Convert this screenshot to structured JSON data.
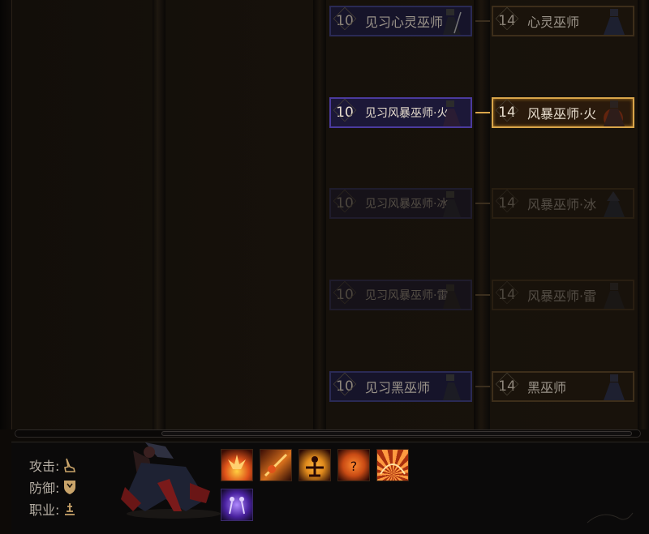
{
  "tree": {
    "rows": [
      {
        "left": {
          "level": "10",
          "name": "见习心灵巫师",
          "state": "normal"
        },
        "right": {
          "level": "14",
          "name": "心灵巫师",
          "state": "normal"
        }
      },
      {
        "left": {
          "level": "10",
          "name": "见习风暴巫师·火",
          "state": "active"
        },
        "right": {
          "level": "14",
          "name": "风暴巫师·火",
          "state": "selected"
        }
      },
      {
        "left": {
          "level": "10",
          "name": "见习风暴巫师·冰",
          "state": "dim"
        },
        "right": {
          "level": "14",
          "name": "风暴巫师·冰",
          "state": "dim"
        }
      },
      {
        "left": {
          "level": "10",
          "name": "见习风暴巫师·雷",
          "state": "dim"
        },
        "right": {
          "level": "14",
          "name": "风暴巫师·雷",
          "state": "dim"
        }
      },
      {
        "left": {
          "level": "10",
          "name": "见习黑巫师",
          "state": "normal"
        },
        "right": {
          "level": "14",
          "name": "黑巫师",
          "state": "normal"
        }
      }
    ]
  },
  "stats": {
    "attack_label": "攻击:",
    "defense_label": "防御:",
    "class_label": "职业:",
    "attack_icon": "sword-hand-icon",
    "defense_icon": "shield-icon",
    "class_icon": "class-emblem-icon"
  },
  "skills": [
    {
      "icon": "fire-burst-icon",
      "color": "#e0531a"
    },
    {
      "icon": "flaming-spear-icon",
      "color": "#d9701c"
    },
    {
      "icon": "fire-figure-icon",
      "color": "#e08a1c"
    },
    {
      "icon": "fire-mystery-icon",
      "color": "#c84a14"
    },
    {
      "icon": "fire-wave-icon",
      "color": "#e8702a"
    },
    {
      "icon": "twin-shadow-icon",
      "color": "#7a4ad0"
    }
  ],
  "colors": {
    "accent_gold": "#d9a54a",
    "node_blue_border": "#2a2a55",
    "node_active_border": "#4b3a9e"
  }
}
